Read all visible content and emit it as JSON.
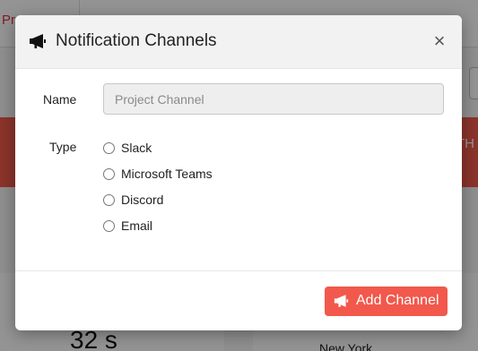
{
  "background": {
    "top_tab_label": "Pro",
    "banner_text": "TH",
    "metric_value": "32 s",
    "city": "New York"
  },
  "modal": {
    "title": "Notification Channels",
    "title_icon": "megaphone-icon",
    "close_icon": "close-icon",
    "close_label": "×",
    "name_label": "Name",
    "name_placeholder": "Project Channel",
    "name_value": "",
    "type_label": "Type",
    "type_options": [
      {
        "label": "Slack",
        "selected": false
      },
      {
        "label": "Microsoft Teams",
        "selected": false
      },
      {
        "label": "Discord",
        "selected": false
      },
      {
        "label": "Email",
        "selected": false
      }
    ],
    "add_button_label": "Add Channel",
    "add_button_icon": "megaphone-icon"
  },
  "colors": {
    "accent": "#f2584b",
    "banner": "#ef5a4b",
    "header_bg": "#f2f2f2"
  }
}
